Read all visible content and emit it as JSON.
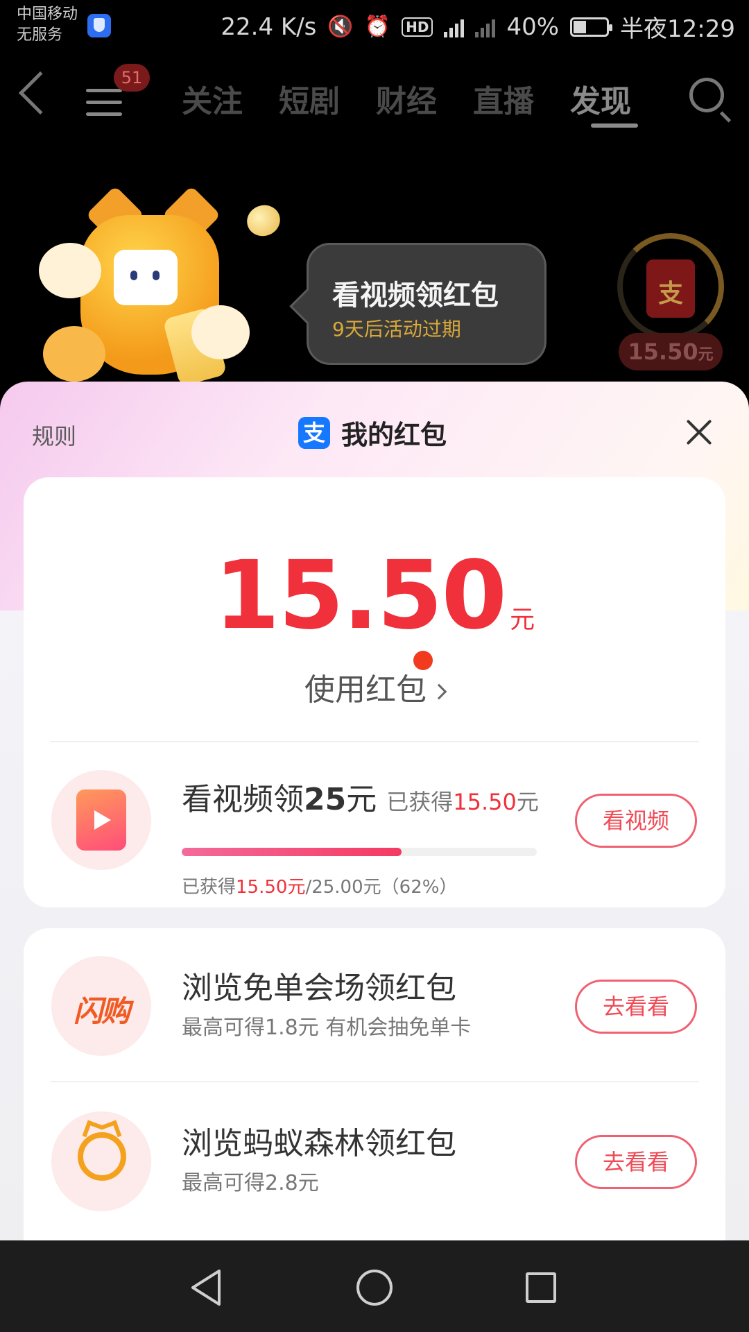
{
  "status_bar": {
    "carrier_line1": "中国移动",
    "carrier_line2": "无服务",
    "net_speed": "22.4 K/s",
    "hd": "HD",
    "battery": "40%",
    "time": "半夜12:29"
  },
  "top_nav": {
    "badge_count": "51",
    "tabs": [
      {
        "label": "关注"
      },
      {
        "label": "短剧"
      },
      {
        "label": "财经"
      },
      {
        "label": "直播"
      },
      {
        "label": "发现"
      }
    ],
    "active_tab": "发现"
  },
  "promo": {
    "bubble_title": "看视频领红包",
    "bubble_sub": "9天后活动过期",
    "envelope_char": "支",
    "pill_amount": "15.50",
    "pill_unit": "元"
  },
  "sheet": {
    "rules_label": "规则",
    "title": "我的红包",
    "alipay_char": "支",
    "amount": "15.50",
    "amount_unit": "元",
    "use_label": "使用红包",
    "video_task": {
      "title_prefix": "看视频领",
      "title_amount": "25",
      "title_unit": "元",
      "earned_label": "已获得",
      "earned_value": "15.50",
      "earned_unit": "元",
      "progress_prefix": "已获得",
      "progress_value": "15.50元",
      "progress_suffix": "/25.00元（62%）",
      "progress_fraction": 0.62,
      "button": "看视频"
    },
    "tasks": [
      {
        "logo": "闪购",
        "title": "浏览免单会场领红包",
        "sub": "最高可得1.8元 有机会抽免单卡",
        "button": "去看看"
      },
      {
        "title": "浏览蚂蚁森林领红包",
        "sub": "最高可得2.8元",
        "button": "去看看"
      }
    ]
  },
  "colors": {
    "accent_red": "#f0303a",
    "alipay_blue": "#1677ff",
    "button_border": "#f06070"
  }
}
